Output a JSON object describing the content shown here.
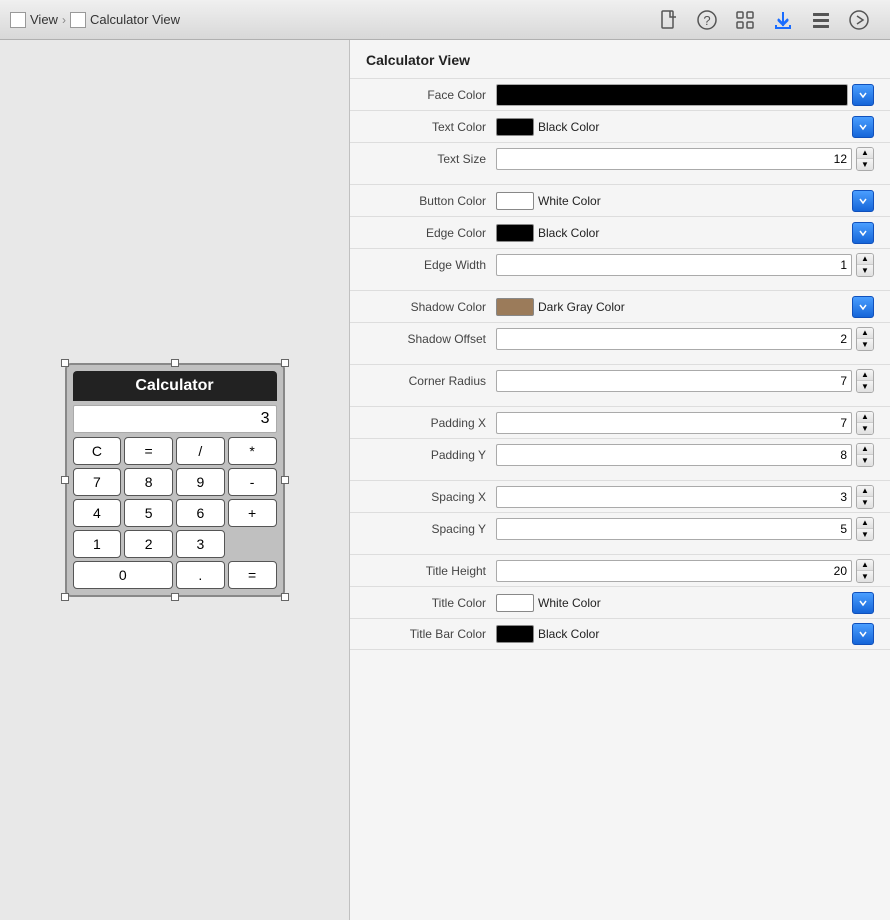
{
  "toolbar": {
    "breadcrumb": [
      {
        "label": "View",
        "icon": "view-icon"
      },
      {
        "label": "Calculator View",
        "icon": "calc-view-icon"
      }
    ],
    "icons": [
      {
        "name": "file-icon",
        "symbol": "📄",
        "active": false
      },
      {
        "name": "help-icon",
        "symbol": "?",
        "active": false,
        "circle": true
      },
      {
        "name": "grid-icon",
        "symbol": "⊞",
        "active": false
      },
      {
        "name": "download-icon",
        "symbol": "↓",
        "active": true
      },
      {
        "name": "list-icon",
        "symbol": "≡",
        "active": false
      },
      {
        "name": "arrow-icon",
        "symbol": "→",
        "active": false
      }
    ]
  },
  "inspector": {
    "title": "Calculator View",
    "properties": [
      {
        "id": "face-color",
        "label": "Face Color",
        "type": "color-only",
        "swatch": "#000000",
        "swatchBg": "linear-gradient(to right, #000, #000)",
        "hasDropdown": true
      },
      {
        "id": "text-color",
        "label": "Text Color",
        "type": "color-text",
        "swatchBg": "#000000",
        "colorText": "Black Color",
        "hasDropdown": true
      },
      {
        "id": "text-size",
        "label": "Text Size",
        "type": "number-stepper",
        "value": "12"
      },
      {
        "id": "button-color",
        "label": "Button Color",
        "type": "color-text",
        "swatchBg": "#ffffff",
        "colorText": "White Color",
        "hasDropdown": true
      },
      {
        "id": "edge-color",
        "label": "Edge Color",
        "type": "color-text",
        "swatchBg": "#000000",
        "colorText": "Black Color",
        "hasDropdown": true
      },
      {
        "id": "edge-width",
        "label": "Edge Width",
        "type": "number-stepper",
        "value": "1"
      },
      {
        "id": "shadow-color",
        "label": "Shadow Color",
        "type": "color-text",
        "swatchBg": "#9b7b5a",
        "colorText": "Dark Gray Color",
        "hasDropdown": true
      },
      {
        "id": "shadow-offset",
        "label": "Shadow Offset",
        "type": "number-stepper",
        "value": "2"
      },
      {
        "id": "corner-radius",
        "label": "Corner Radius",
        "type": "number-stepper",
        "value": "7"
      },
      {
        "id": "padding-x",
        "label": "Padding X",
        "type": "number-stepper",
        "value": "7"
      },
      {
        "id": "padding-y",
        "label": "Padding Y",
        "type": "number-stepper",
        "value": "8"
      },
      {
        "id": "spacing-x",
        "label": "Spacing X",
        "type": "number-stepper",
        "value": "3"
      },
      {
        "id": "spacing-y",
        "label": "Spacing Y",
        "type": "number-stepper",
        "value": "5"
      },
      {
        "id": "title-height",
        "label": "Title Height",
        "type": "number-stepper",
        "value": "20"
      },
      {
        "id": "title-color",
        "label": "Title Color",
        "type": "color-text",
        "swatchBg": "#ffffff",
        "colorText": "White Color",
        "hasDropdown": true
      },
      {
        "id": "title-bar-color",
        "label": "Title Bar Color",
        "type": "color-text",
        "swatchBg": "#000000",
        "colorText": "Black Color",
        "hasDropdown": true
      }
    ]
  },
  "calculator": {
    "title": "Calculator",
    "display": "3",
    "buttons": [
      {
        "label": "C"
      },
      {
        "label": "="
      },
      {
        "label": "/"
      },
      {
        "label": "*"
      },
      {
        "label": "7"
      },
      {
        "label": "8"
      },
      {
        "label": "9"
      },
      {
        "label": "-"
      },
      {
        "label": "4"
      },
      {
        "label": "5"
      },
      {
        "label": "6"
      },
      {
        "label": "+"
      },
      {
        "label": "1"
      },
      {
        "label": "2"
      },
      {
        "label": "3"
      },
      {
        "label": ""
      },
      {
        "label": "0",
        "wide": true
      },
      {
        "label": "."
      },
      {
        "label": "="
      }
    ]
  },
  "spacerGroups": [
    2,
    5,
    7,
    9,
    11,
    13
  ]
}
